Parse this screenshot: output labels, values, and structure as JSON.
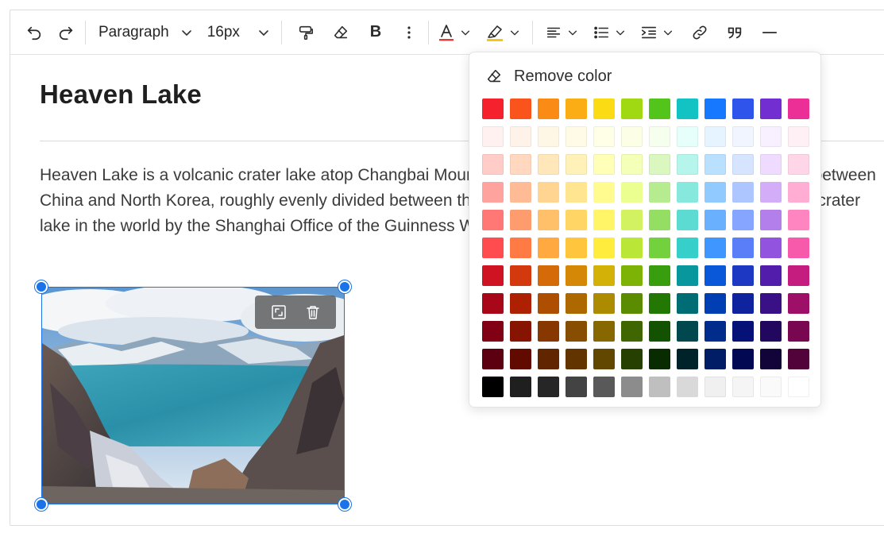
{
  "toolbar": {
    "undo_icon": "undo-icon",
    "redo_icon": "redo-icon",
    "block_format": "Paragraph",
    "font_size": "16px",
    "format_painter_icon": "format-painter-icon",
    "clear_format_icon": "eraser-icon",
    "bold_label": "B",
    "more_icon": "more-vertical-icon",
    "font_color_accent": "#e53935",
    "highlight_accent": "#f2c811"
  },
  "document": {
    "title": "Heaven Lake",
    "paragraph": "Heaven Lake is a volcanic crater lake atop Changbai Mountain or Baekdu Mountain. It lies on the border between China and North Korea, roughly evenly divided between the two countries. It is recognized as the highest crater lake in the world by the Shanghai Office of the Guinness World Records."
  },
  "color_popup": {
    "remove_label": "Remove color",
    "palette": [
      [
        "#f5222d",
        "#fa541c",
        "#fa8c16",
        "#faad14",
        "#fadb14",
        "#a0d911",
        "#52c41a",
        "#13c2c2",
        "#1677ff",
        "#2f54eb",
        "#722ed1",
        "#eb2f96"
      ],
      [
        "#fff1f0",
        "#fff2e8",
        "#fff7e6",
        "#fffbe6",
        "#feffe6",
        "#fcffe6",
        "#f6ffed",
        "#e6fffb",
        "#e6f4ff",
        "#f0f5ff",
        "#f9f0ff",
        "#fff0f6"
      ],
      [
        "#ffccc7",
        "#ffd8bf",
        "#ffe7ba",
        "#fff1b8",
        "#ffffb8",
        "#f4ffb8",
        "#d9f7be",
        "#b5f5ec",
        "#bae0ff",
        "#d6e4ff",
        "#efdbff",
        "#ffd6e7"
      ],
      [
        "#ffa39e",
        "#ffbb96",
        "#ffd591",
        "#ffe58f",
        "#fffb8f",
        "#eaff8f",
        "#b7eb8f",
        "#87e8de",
        "#91caff",
        "#adc6ff",
        "#d3adf7",
        "#ffadd2"
      ],
      [
        "#ff7875",
        "#ff9c6e",
        "#ffc069",
        "#ffd666",
        "#fff566",
        "#d3f261",
        "#95de64",
        "#5cdbd3",
        "#69b1ff",
        "#85a5ff",
        "#b37feb",
        "#ff85c0"
      ],
      [
        "#ff4d4f",
        "#ff7a45",
        "#ffa940",
        "#ffc53d",
        "#ffec3d",
        "#bae637",
        "#73d13d",
        "#36cfc9",
        "#4096ff",
        "#597ef7",
        "#9254de",
        "#f759ab"
      ],
      [
        "#cf1322",
        "#d4380d",
        "#d46b08",
        "#d48806",
        "#d4b106",
        "#7cb305",
        "#389e0d",
        "#08979c",
        "#0958d9",
        "#1d39c4",
        "#531dab",
        "#c41d7f"
      ],
      [
        "#a8071a",
        "#ad2102",
        "#ad4e00",
        "#ad6800",
        "#ad8b00",
        "#5b8c00",
        "#237804",
        "#006d75",
        "#003eb3",
        "#10239e",
        "#391085",
        "#9e1068"
      ],
      [
        "#820014",
        "#871400",
        "#873800",
        "#874d00",
        "#876800",
        "#3f6600",
        "#135200",
        "#00474f",
        "#002c8c",
        "#061178",
        "#22075e",
        "#780650"
      ],
      [
        "#5c0011",
        "#610b00",
        "#612500",
        "#613400",
        "#614700",
        "#254000",
        "#092b00",
        "#002329",
        "#001d66",
        "#030852",
        "#120338",
        "#520339"
      ],
      [
        "#000000",
        "#1f1f1f",
        "#262626",
        "#434343",
        "#595959",
        "#8c8c8c",
        "#bfbfbf",
        "#d9d9d9",
        "#f0f0f0",
        "#f5f5f5",
        "#fafafa",
        "#ffffff"
      ]
    ]
  }
}
